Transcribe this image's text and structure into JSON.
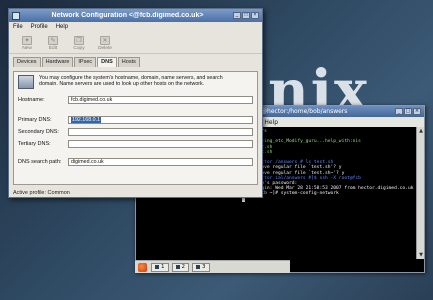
{
  "desktop": {
    "logo_text": "nix"
  },
  "terminal": {
    "title": "root@hector:/home/bob/answers",
    "menu": [
      "ings",
      "Help"
    ],
    "lines": [
      "./answers",
      "",
      ":59 Editing_etc_Modify_guru...help_with:nis",
      ":41 test.sh",
      ":41 test.sh",
      "",
      "root@hector /answers # ls test.sh",
      "rm: remove regular file `test.sh'? y",
      "rm: remove regular file `test.sh~'? y",
      "[bob@hector ial/answers #]$ ssh -X root@fcb",
      "root@fcb's password:",
      "Last login: Wed Mar 28 21:58:53 2007 from hector.digimed.co.uk",
      "[root@fcb ~]# system-config-network"
    ],
    "taskbar": {
      "workspaces": [
        "1",
        "2",
        "3"
      ]
    }
  },
  "network_window": {
    "title": "Network Configuration <@fcb.digimed.co.uk>",
    "menu": [
      "File",
      "Profile",
      "Help"
    ],
    "toolbar": [
      "New",
      "Edit",
      "Copy",
      "Delete"
    ],
    "tabs": [
      "Devices",
      "Hardware",
      "IPsec",
      "DNS",
      "Hosts"
    ],
    "active_tab": "DNS",
    "description": "You may configure the system's hostname, domain, name servers, and search domain. Name servers are used to look up other hosts on the network.",
    "fields": {
      "hostname_label": "Hostname:",
      "hostname_value": "fcb.digimed.co.uk",
      "primary_dns_label": "Primary DNS:",
      "primary_dns_value": "192.168.0.1",
      "secondary_dns_label": "Secondary DNS:",
      "secondary_dns_value": "",
      "tertiary_dns_label": "Tertiary DNS:",
      "tertiary_dns_value": "",
      "search_label": "DNS search path:",
      "search_value": "digimed.co.uk"
    },
    "status": "Active profile: Common"
  }
}
